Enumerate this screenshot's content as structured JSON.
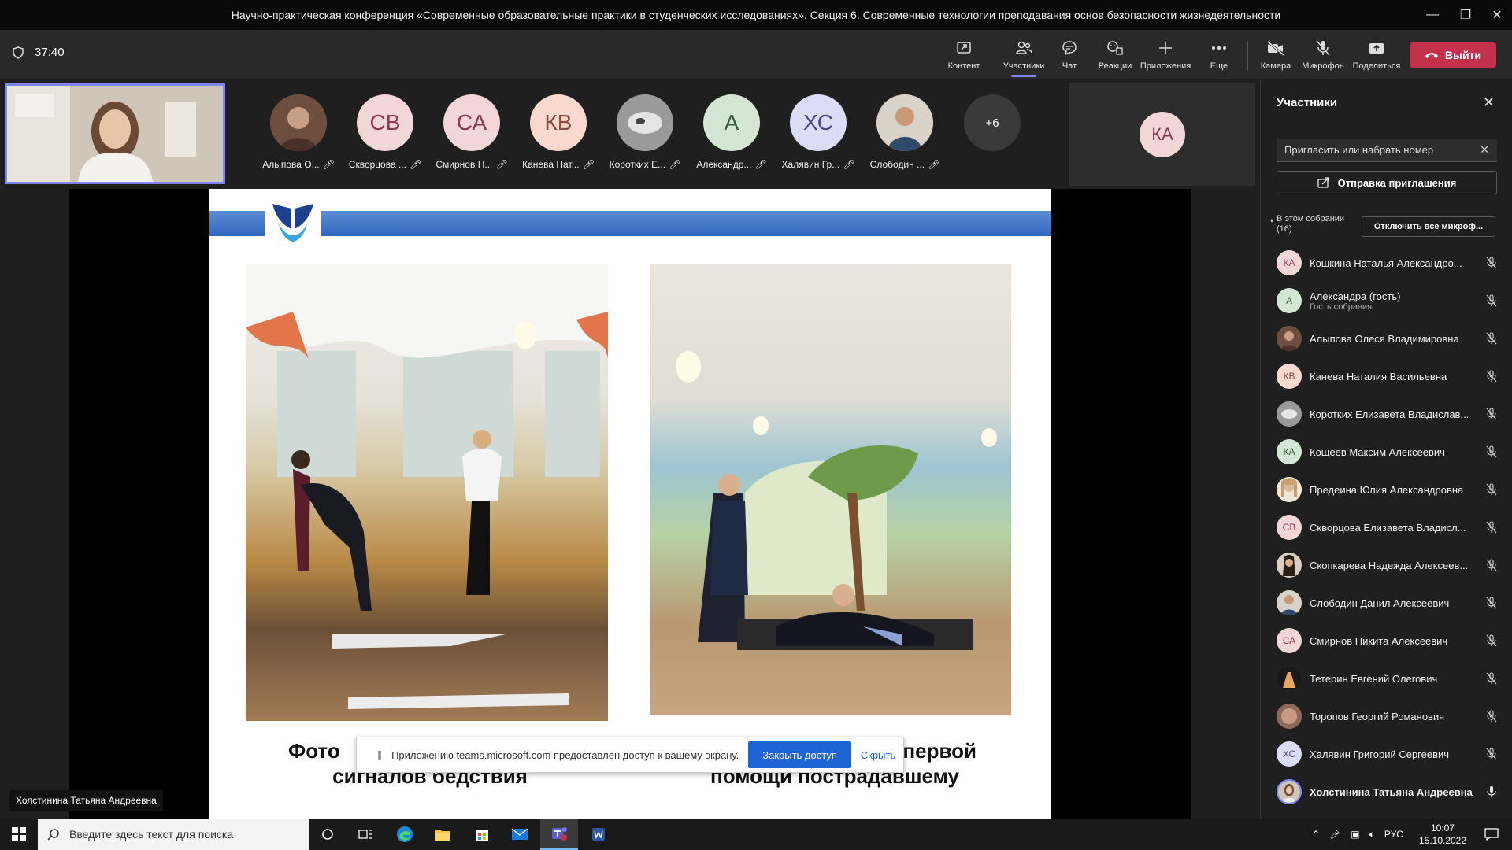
{
  "window": {
    "title": "Научно-практическая конференция «Современные образовательные практики в студенческих исследованиях». Секция 6. Современные технологии преподавания основ безопасности жизнедеятельности"
  },
  "toolbar": {
    "timer": "37:40",
    "buttons": [
      {
        "label": "Контент",
        "icon": "share-screen-icon"
      },
      {
        "label": "Участники",
        "icon": "people-icon"
      },
      {
        "label": "Чат",
        "icon": "chat-icon"
      },
      {
        "label": "Реакции",
        "icon": "reactions-icon"
      },
      {
        "label": "Приложения",
        "icon": "plus-icon"
      },
      {
        "label": "Еще",
        "icon": "more-icon"
      },
      {
        "label": "Камера",
        "icon": "camera-off-icon"
      },
      {
        "label": "Микрофон",
        "icon": "mic-off-icon"
      },
      {
        "label": "Поделиться",
        "icon": "share-up-icon"
      }
    ],
    "leave_label": "Выйти",
    "leave_color": "#c4314b"
  },
  "strip": {
    "participants": [
      {
        "initials": "",
        "name": "Алыпова О...",
        "color": "#7a5a4a"
      },
      {
        "initials": "СВ",
        "name": "Скворцова ...",
        "color": "#f3d6d8"
      },
      {
        "initials": "СА",
        "name": "Смирнов Н...",
        "color": "#f3d6d8"
      },
      {
        "initials": "КВ",
        "name": "Канева Нат...",
        "color": "#fbd9cf"
      },
      {
        "initials": "",
        "name": "Коротких Е...",
        "color": "#8a8a8a"
      },
      {
        "initials": "А",
        "name": "Александр...",
        "color": "#d4e6d3"
      },
      {
        "initials": "ХС",
        "name": "Халявин Гр...",
        "color": "#dcdcf6"
      },
      {
        "initials": "",
        "name": "Слободин ...",
        "color": "#a48a72"
      }
    ],
    "more": "+6",
    "tile_initials": "КА"
  },
  "slide": {
    "caption_left_line1": "Фото",
    "caption_left_line2": "сигналов бедствия",
    "caption_right_line1": "первой",
    "caption_right_line2": "помощи пострадавшему"
  },
  "share_notice": {
    "text": "Приложению teams.microsoft.com предоставлен доступ к вашему экрану.",
    "stop_label": "Закрыть доступ",
    "hide_label": "Скрыть"
  },
  "presenter_name": "Холстинина Татьяна Андреевна",
  "panel": {
    "title": "Участники",
    "invite_placeholder": "Пригласить или набрать номер",
    "invite_button": "Отправка приглашения",
    "section_label": "В этом собрании",
    "section_count": "(16)",
    "mute_all": "Отключить все микроф...",
    "people": [
      {
        "initials": "КА",
        "name": "Кошкина Наталья Александро...",
        "sub": "",
        "color": "#f3d6d8",
        "fg": "#8a3c4a"
      },
      {
        "initials": "А",
        "name": "Александра (гость)",
        "sub": "Гость собрания",
        "color": "#d4e6d3",
        "fg": "#3c5a3c"
      },
      {
        "initials": "",
        "name": "Алыпова Олеся Владимировна",
        "sub": "",
        "color": "#7a5a4a",
        "fg": "#fff"
      },
      {
        "initials": "КВ",
        "name": "Канева Наталия Васильевна",
        "sub": "",
        "color": "#fbd9cf",
        "fg": "#8a4a3c"
      },
      {
        "initials": "",
        "name": "Коротких Елизавета Владислав...",
        "sub": "",
        "color": "#8a8a8a",
        "fg": "#fff"
      },
      {
        "initials": "КА",
        "name": "Кощеев Максим Алексеевич",
        "sub": "",
        "color": "#d4e6d3",
        "fg": "#3c5a3c"
      },
      {
        "initials": "",
        "name": "Предеина Юлия Александровна",
        "sub": "",
        "color": "#c8aa8a",
        "fg": "#fff"
      },
      {
        "initials": "СВ",
        "name": "Скворцова Елизавета Владисл...",
        "sub": "",
        "color": "#f3d6d8",
        "fg": "#8a3c4a"
      },
      {
        "initials": "",
        "name": "Скопкарева Надежда Алексеев...",
        "sub": "",
        "color": "#5a4a3a",
        "fg": "#fff"
      },
      {
        "initials": "",
        "name": "Слободин Данил Алексеевич",
        "sub": "",
        "color": "#a48a72",
        "fg": "#fff"
      },
      {
        "initials": "СА",
        "name": "Смирнов Никита Алексеевич",
        "sub": "",
        "color": "#f3d6d8",
        "fg": "#8a3c4a"
      },
      {
        "initials": "",
        "name": "Тетерин Евгений Олегович",
        "sub": "",
        "color": "#b08050",
        "fg": "#fff"
      },
      {
        "initials": "",
        "name": "Торопов Георгий Романович",
        "sub": "",
        "color": "#9a7a6a",
        "fg": "#fff"
      },
      {
        "initials": "ХС",
        "name": "Халявин Григорий Сергеевич",
        "sub": "",
        "color": "#dcdcf6",
        "fg": "#4a4a8a"
      },
      {
        "initials": "",
        "name": "Холстинина Татьяна Андреевна",
        "sub": "",
        "color": "#8a7a9a",
        "fg": "#fff"
      }
    ]
  },
  "taskbar": {
    "search_placeholder": "Введите здесь текст для поиска",
    "lang": "РУС",
    "time": "10:07",
    "date": "15.10.2022"
  }
}
